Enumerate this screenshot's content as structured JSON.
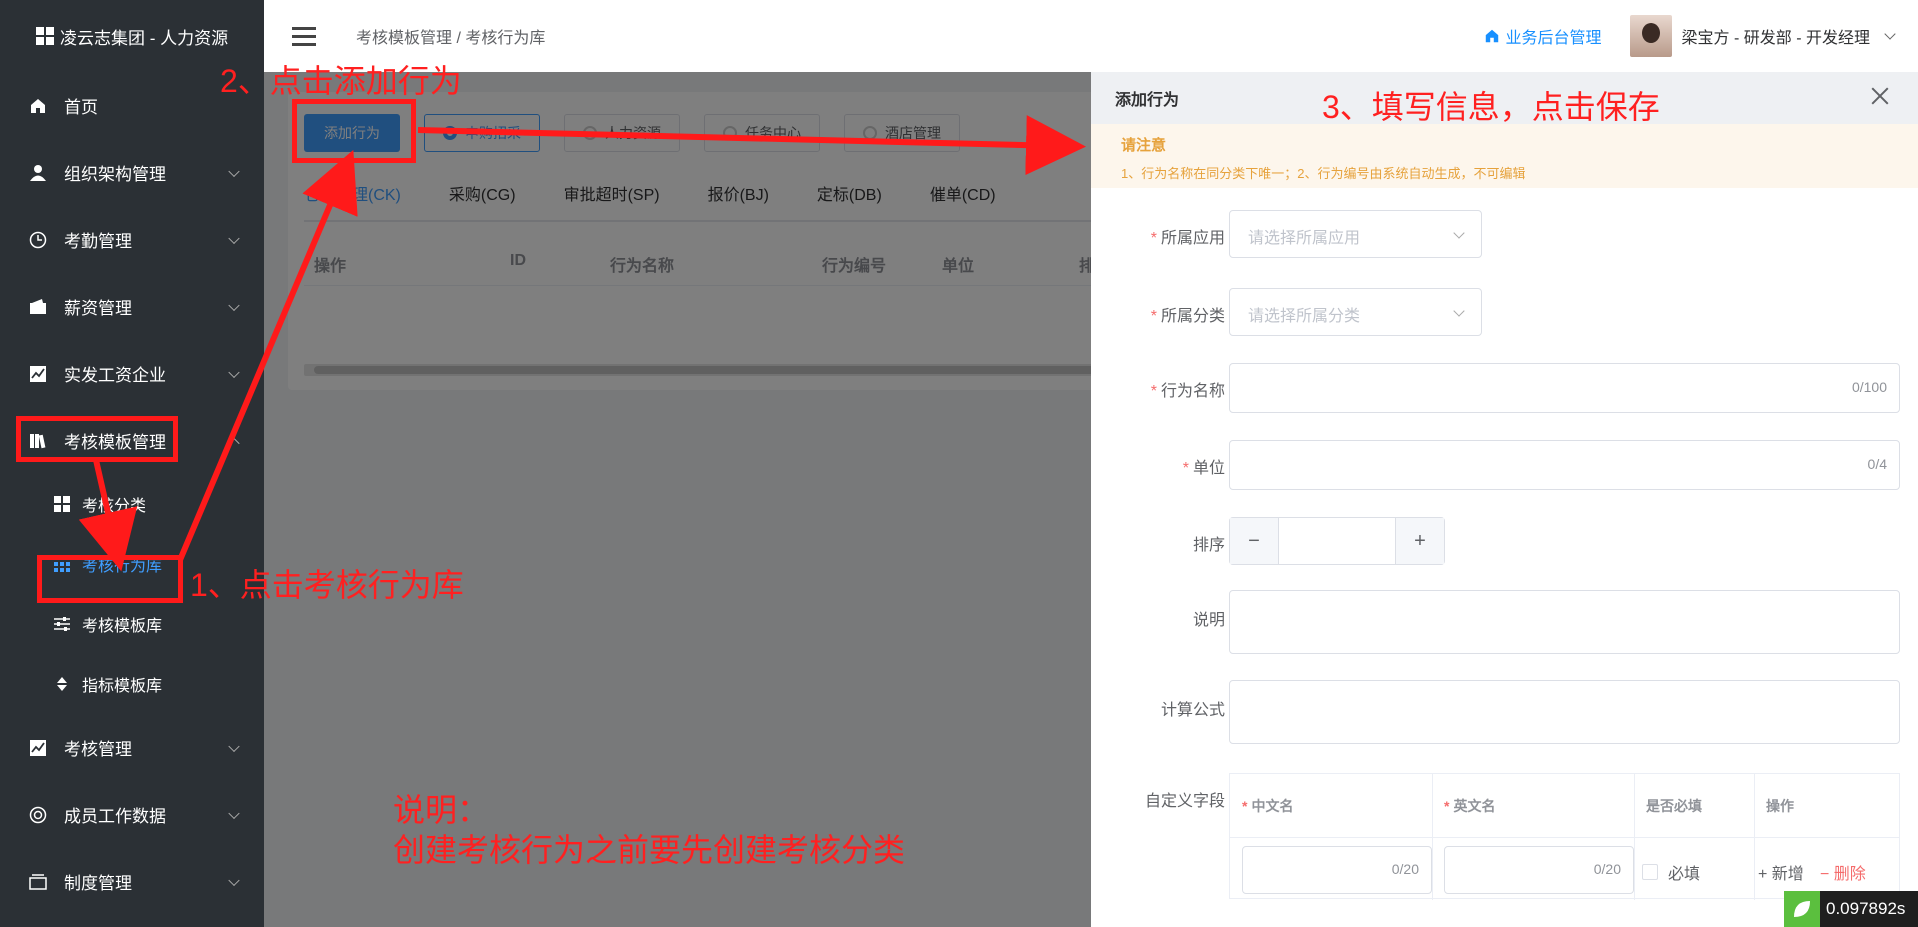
{
  "app": {
    "title": "凌云志集团 - 人力资源"
  },
  "sidebar": {
    "items": [
      {
        "label": "首页",
        "icon": "home-icon"
      },
      {
        "label": "组织架构管理",
        "icon": "user-icon"
      },
      {
        "label": "考勤管理",
        "icon": "clock-icon"
      },
      {
        "label": "薪资管理",
        "icon": "wallet-icon"
      },
      {
        "label": "实发工资企业",
        "icon": "chart-icon"
      },
      {
        "label": "考核模板管理",
        "icon": "book-icon"
      },
      {
        "label": "考核管理",
        "icon": "chart-icon"
      },
      {
        "label": "成员工作数据",
        "icon": "circle-icon"
      },
      {
        "label": "制度管理",
        "icon": "folder-icon"
      }
    ],
    "submenu": [
      {
        "label": "考核分类",
        "icon": "grid-icon"
      },
      {
        "label": "考核行为库",
        "icon": "apps-icon",
        "active": true
      },
      {
        "label": "考核模板库",
        "icon": "sliders-icon"
      },
      {
        "label": "指标模板库",
        "icon": "sort-icon"
      }
    ]
  },
  "header": {
    "breadcrumb": "考核模板管理 / 考核行为库",
    "biz_link": "业务后台管理",
    "user": "梁宝方 - 研发部 - 开发经理"
  },
  "toolbar": {
    "add_button": "添加行为",
    "chips": [
      "申购招采",
      "人力资源",
      "任务中心",
      "酒店管理"
    ]
  },
  "tabs": [
    "仓库管理(CK)",
    "采购(CG)",
    "审批超时(SP)",
    "报价(BJ)",
    "定标(DB)",
    "催单(CD)"
  ],
  "table": {
    "headers": [
      "操作",
      "ID",
      "行为名称",
      "行为编号",
      "单位",
      "排"
    ]
  },
  "drawer": {
    "title": "添加行为",
    "notice_title": "请注意",
    "notice_text": "1、行为名称在同分类下唯一；2、行为编号由系统自动生成，不可编辑",
    "fields": {
      "app_label": "所属应用",
      "app_placeholder": "请选择所属应用",
      "cat_label": "所属分类",
      "cat_placeholder": "请选择所属分类",
      "name_label": "行为名称",
      "name_counter": "0/100",
      "unit_label": "单位",
      "unit_counter": "0/4",
      "sort_label": "排序",
      "desc_label": "说明",
      "formula_label": "计算公式",
      "custom_label": "自定义字段"
    },
    "custom_table": {
      "col_cn": "中文名",
      "col_en": "英文名",
      "col_required": "是否必填",
      "col_ops": "操作",
      "cn_counter": "0/20",
      "en_counter": "0/20",
      "required_label": "必填",
      "add": "新增",
      "delete": "删除"
    }
  },
  "annotations": {
    "step1": "1、点击考核行为库",
    "step2": "2、点击添加行为",
    "step3": "3、填写信息，点击保存",
    "note_title": "说明：",
    "note_text": "创建考核行为之前要先创建考核分类"
  },
  "timer": "0.097892s",
  "colors": {
    "accent": "#409eff",
    "sidebar": "#2b3035",
    "annotation": "#ff1a1a"
  }
}
